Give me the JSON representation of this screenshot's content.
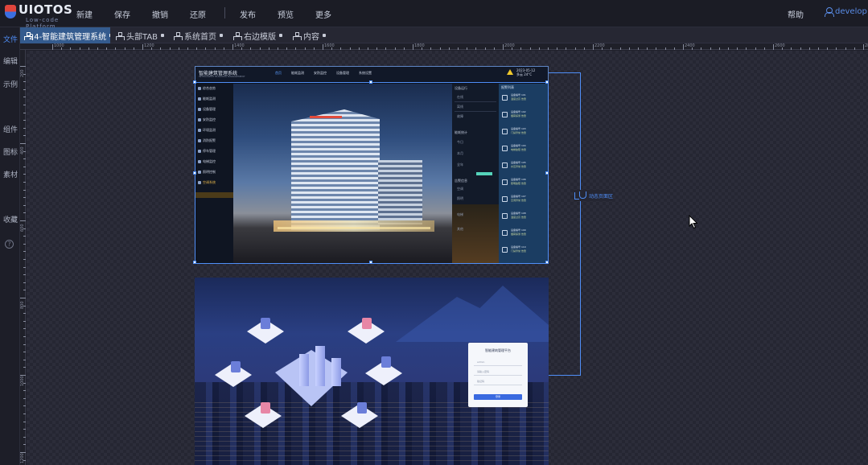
{
  "topbar": {
    "logo_text": "UIOTOS",
    "logo_sub": "Low-code Platform",
    "menu": [
      "新建",
      "保存",
      "撤销",
      "还原",
      "发布",
      "预览",
      "更多"
    ],
    "help": "帮助",
    "user": "develop"
  },
  "sidebar": {
    "items": [
      {
        "label": "文件",
        "active": true
      },
      {
        "label": "编辑",
        "active": false
      },
      {
        "label": "示例",
        "active": false
      },
      {
        "label": "组件",
        "active": false
      },
      {
        "label": "图标",
        "active": false
      },
      {
        "label": "素材",
        "active": false
      },
      {
        "label": "收藏",
        "active": false
      }
    ],
    "help_glyph": "?"
  },
  "tabs": [
    {
      "label": "24-智能建筑管理系统",
      "active": true
    },
    {
      "label": "头部TAB",
      "active": false
    },
    {
      "label": "系统首页",
      "active": false
    },
    {
      "label": "右边模版",
      "active": false
    },
    {
      "label": "内容",
      "active": false
    }
  ],
  "ruler": {
    "h_labels": [
      "1000",
      "1200",
      "1400",
      "1600",
      "1800",
      "2000",
      "2200",
      "2400",
      "2600",
      "2800",
      "3000"
    ],
    "v_labels": [
      "200",
      "400",
      "600",
      "800",
      "1000",
      "1200"
    ]
  },
  "page1": {
    "title": "智能建筑管理系统",
    "subtitle": "INTELLIGENT BUILDING MANAGEMENT",
    "nav": [
      "首页",
      "能耗监测",
      "安防监控",
      "设备管理",
      "系统设置"
    ],
    "weather": [
      "2023-05-12",
      "多云 24°C"
    ],
    "left_menu": [
      "综合态势",
      "能耗监测",
      "设备管理",
      "安防监控",
      "环境监测",
      "消防报警",
      "停车管理",
      "电梯监控",
      "照明控制",
      "空调系统"
    ],
    "mid_headers": [
      "设备运行",
      "能耗统计",
      "告警信息"
    ],
    "mid_labels": [
      "在线",
      "离线",
      "故障",
      "今日",
      "本月",
      "全年",
      "空调",
      "照明",
      "电梯",
      "其他"
    ],
    "right_title": "报警列表",
    "right_items": [
      {
        "l1": "设备编号 101",
        "l2": "温度过高 告警"
      },
      {
        "l1": "设备编号 102",
        "l2": "烟雾探测 告警"
      },
      {
        "l1": "设备编号 103",
        "l2": "门禁异常 告警"
      },
      {
        "l1": "设备编号 104",
        "l2": "电梯故障 告警"
      },
      {
        "l1": "设备编号 105",
        "l2": "水压异常 告警"
      },
      {
        "l1": "设备编号 106",
        "l2": "照明故障 告警"
      },
      {
        "l1": "设备编号 107",
        "l2": "空调异常 告警"
      },
      {
        "l1": "设备编号 108",
        "l2": "温度过高 告警"
      },
      {
        "l1": "设备编号 109",
        "l2": "烟雾探测 告警"
      },
      {
        "l1": "设备编号 110",
        "l2": "门禁异常 告警"
      }
    ]
  },
  "connector": {
    "label": "动态页面区"
  },
  "page2": {
    "login_title": "智能建筑管理平台",
    "username": "admin",
    "password": "请输入密码",
    "captcha": "验证码",
    "login_button": "登录"
  },
  "colors": {
    "accent": "#4f8ef7",
    "active_tab": "#345b8e",
    "warning": "#f0c92c",
    "panel": "#1b3d62"
  }
}
